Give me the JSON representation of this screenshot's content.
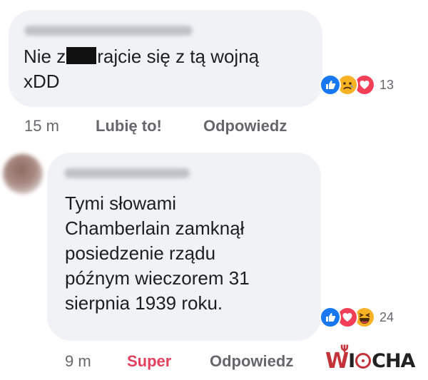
{
  "comments": [
    {
      "text_before_censor": "Nie z",
      "text_after_censor": "rajcie się z tą wojną\nxDD",
      "reactions": [
        "like-icon",
        "sad-icon",
        "love-icon"
      ],
      "reaction_count": "13",
      "time": "15 m",
      "like_action": "Lubię to!",
      "reply_action": "Odpowiedz"
    },
    {
      "text": "Tymi słowami\nChamberlain zamknął\nposiedzenie rządu\npóźnym wieczorem 31\nsierpnia 1939 roku.",
      "reactions": [
        "like-icon",
        "love-icon",
        "haha-icon"
      ],
      "reaction_count": "24",
      "time": "9 m",
      "like_action": "Super",
      "reply_action": "Odpowiedz"
    }
  ],
  "watermark": "WIOCHA",
  "colors": {
    "like": "#1877f2",
    "love": "#f33e58",
    "yellow": "#f7b125",
    "super": "#e4405f",
    "bubble": "#f0f2f5"
  }
}
